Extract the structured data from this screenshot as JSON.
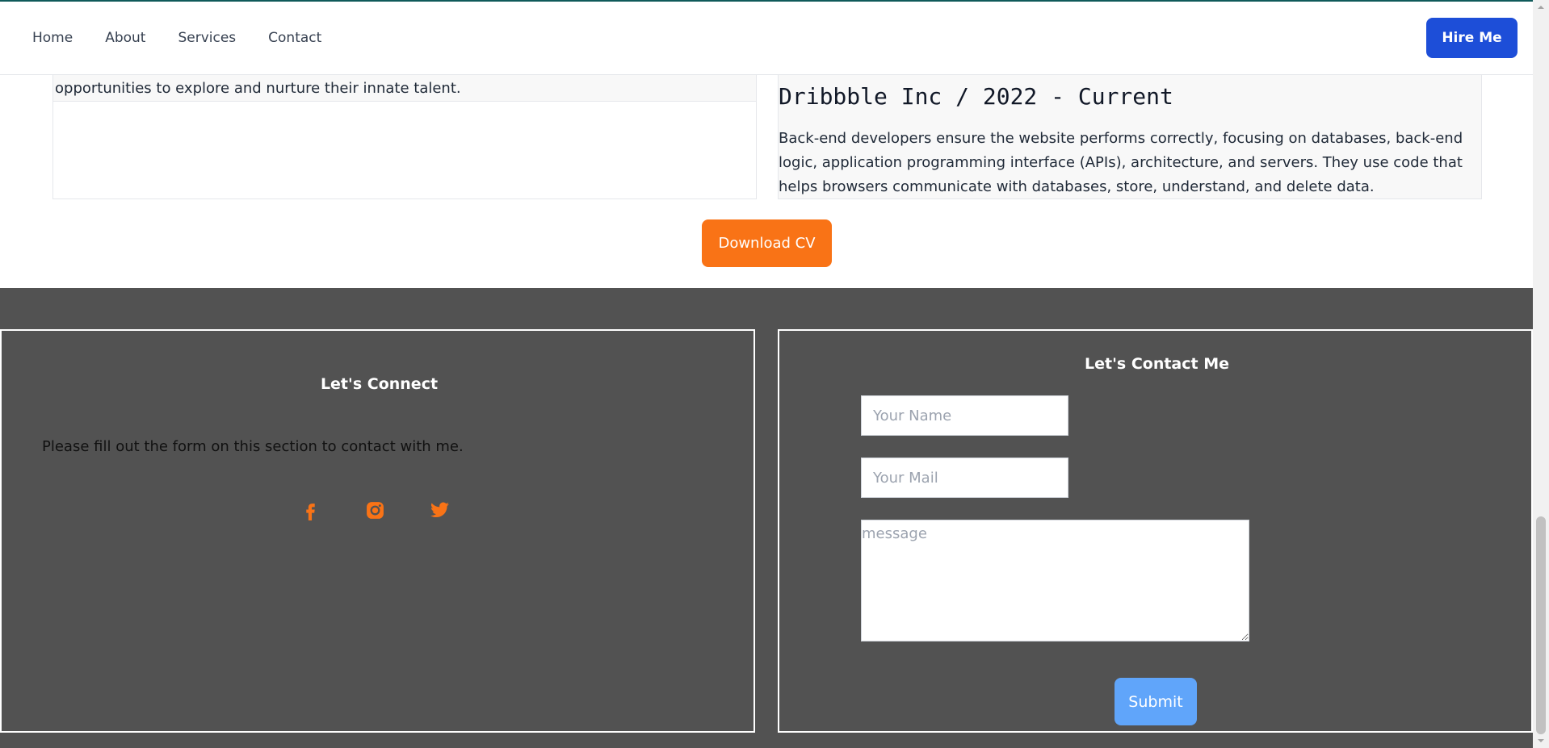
{
  "nav": {
    "links": [
      "Home",
      "About",
      "Services",
      "Contact"
    ],
    "hire_label": "Hire Me"
  },
  "experience": {
    "left_text": "opportunities to explore and nurture their innate talent.",
    "right_title": "Dribbble Inc / 2022 - Current",
    "right_desc": "Back-end developers ensure the website performs correctly, focusing on databases, back-end logic, application programming interface (APIs), architecture, and servers. They use code that helps browsers communicate with databases, store, understand, and delete data."
  },
  "download_label": "Download CV",
  "connect": {
    "title": "Let's Connect",
    "text": "Please fill out the form on this section to contact with me.",
    "social_icons": [
      "facebook-icon",
      "instagram-icon",
      "twitter-icon"
    ]
  },
  "contact": {
    "title": "Let's Contact Me",
    "name_placeholder": "Your Name",
    "mail_placeholder": "Your Mail",
    "message_placeholder": "message",
    "submit_label": "Submit"
  },
  "colors": {
    "primary": "#1d4ed8",
    "accent": "#f97316",
    "footer_bg": "#525252",
    "submit": "#60a5fa"
  }
}
